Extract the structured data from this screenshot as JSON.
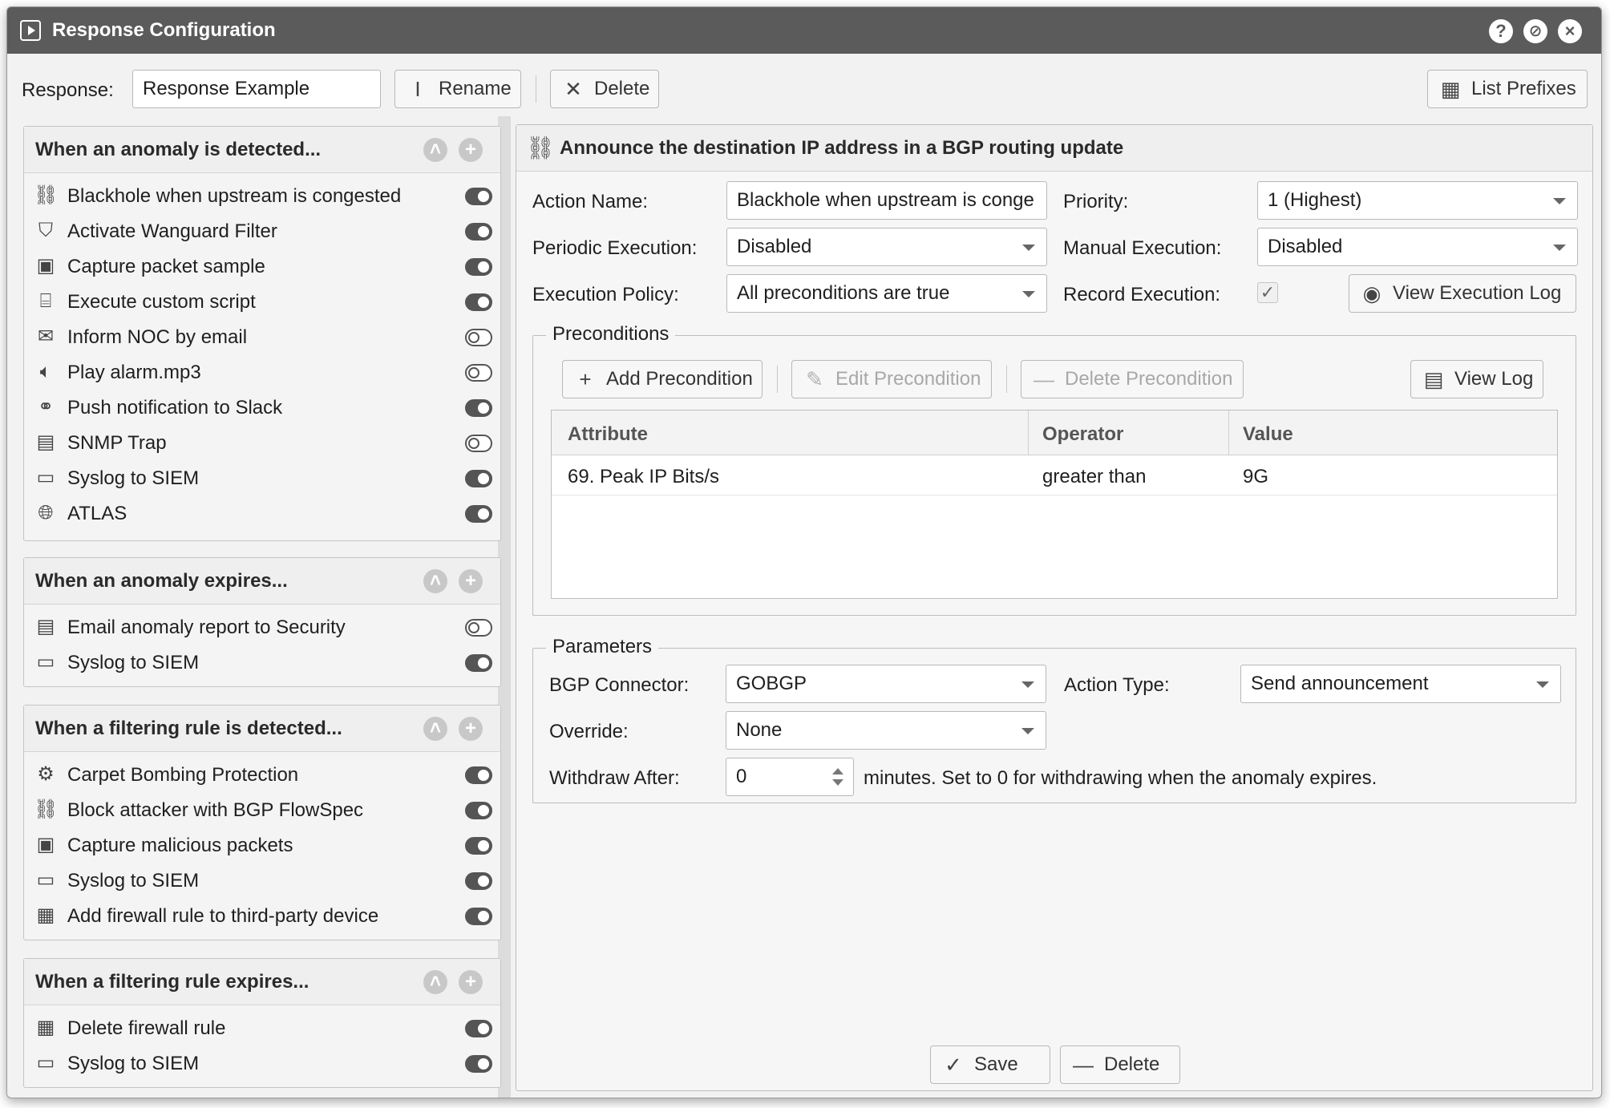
{
  "window": {
    "title": "Response Configuration"
  },
  "toolbar": {
    "response_label": "Response:",
    "response_value": "Response Example",
    "rename_label": "Rename",
    "delete_label": "Delete",
    "list_prefixes_label": "List Prefixes"
  },
  "groups": [
    {
      "title": "When an anomaly is detected...",
      "items": [
        {
          "label": "Blackhole when upstream is congested",
          "icon": "link-icon",
          "on": true
        },
        {
          "label": "Activate Wanguard Filter",
          "icon": "shield-icon",
          "on": true
        },
        {
          "label": "Capture packet sample",
          "icon": "save-icon",
          "on": true
        },
        {
          "label": "Execute custom script",
          "icon": "script-icon",
          "on": true
        },
        {
          "label": "Inform NOC by email",
          "icon": "envelope-icon",
          "on": false
        },
        {
          "label": "Play alarm.mp3",
          "icon": "speaker-icon",
          "on": false
        },
        {
          "label": "Push notification to Slack",
          "icon": "webhook-icon",
          "on": true
        },
        {
          "label": "SNMP Trap",
          "icon": "snmp-icon",
          "on": false
        },
        {
          "label": "Syslog to SIEM",
          "icon": "server-icon",
          "on": true
        },
        {
          "label": "ATLAS",
          "icon": "globe-icon",
          "on": true
        }
      ]
    },
    {
      "title": "When an anomaly expires...",
      "items": [
        {
          "label": "Email anomaly report to Security",
          "icon": "report-icon",
          "on": false
        },
        {
          "label": "Syslog to SIEM",
          "icon": "server-icon",
          "on": true
        }
      ]
    },
    {
      "title": "When a filtering rule is detected...",
      "items": [
        {
          "label": "Carpet Bombing Protection",
          "icon": "gear-icon",
          "on": true
        },
        {
          "label": "Block attacker with BGP FlowSpec",
          "icon": "link-icon",
          "on": true
        },
        {
          "label": "Capture malicious packets",
          "icon": "save-icon",
          "on": true
        },
        {
          "label": "Syslog to SIEM",
          "icon": "server-icon",
          "on": true
        },
        {
          "label": "Add firewall rule to third-party device",
          "icon": "firewall-icon",
          "on": true
        }
      ]
    },
    {
      "title": "When a filtering rule expires...",
      "items": [
        {
          "label": "Delete firewall rule",
          "icon": "firewall-icon",
          "on": true
        },
        {
          "label": "Syslog to SIEM",
          "icon": "server-icon",
          "on": true
        }
      ]
    }
  ],
  "detail": {
    "title": "Announce the destination IP address in a BGP routing update",
    "action_name_label": "Action Name:",
    "action_name_value": "Blackhole when upstream is conge",
    "priority_label": "Priority:",
    "priority_value": "1 (Highest)",
    "periodic_label": "Periodic Execution:",
    "periodic_value": "Disabled",
    "manual_label": "Manual Execution:",
    "manual_value": "Disabled",
    "policy_label": "Execution Policy:",
    "policy_value": "All preconditions are true",
    "record_label": "Record Execution:",
    "record_checked": true,
    "view_exec_log_label": "View Execution Log"
  },
  "preconditions": {
    "legend": "Preconditions",
    "add_label": "Add Precondition",
    "edit_label": "Edit Precondition",
    "delete_label": "Delete Precondition",
    "view_log_label": "View Log",
    "columns": [
      "Attribute",
      "Operator",
      "Value"
    ],
    "rows": [
      {
        "attribute": "69. Peak IP Bits/s",
        "operator": "greater than",
        "value": "9G"
      }
    ]
  },
  "parameters": {
    "legend": "Parameters",
    "bgp_connector_label": "BGP Connector:",
    "bgp_connector_value": "GOBGP",
    "action_type_label": "Action Type:",
    "action_type_value": "Send announcement",
    "override_label": "Override:",
    "override_value": "None",
    "withdraw_label": "Withdraw After:",
    "withdraw_value": "0",
    "withdraw_hint": "minutes. Set to 0 for withdrawing when the anomaly expires."
  },
  "footer": {
    "save_label": "Save",
    "delete_label": "Delete"
  }
}
